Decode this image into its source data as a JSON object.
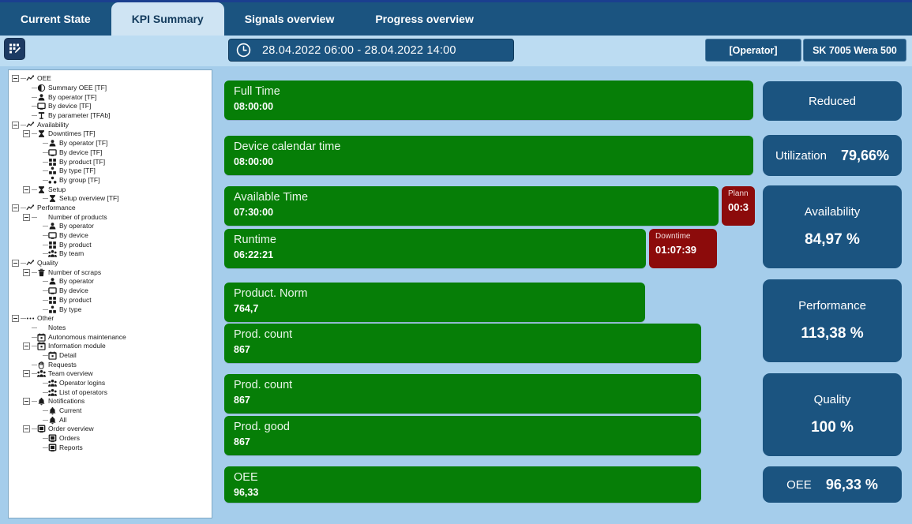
{
  "theme": {
    "background": "#a5cdeb",
    "header_blue": "#1b5480",
    "active_tab_bg": "#cfe4f3",
    "bar_green": "#067e07",
    "bar_red": "#8c0b0b",
    "panel_white": "#ffffff"
  },
  "tabs": [
    {
      "label": "Current State",
      "active": false
    },
    {
      "label": "KPI Summary",
      "active": true
    },
    {
      "label": "Signals overview",
      "active": false
    },
    {
      "label": "Progress overview",
      "active": false
    }
  ],
  "toolbar": {
    "form_icon": "form-edit-icon",
    "clock_icon": "clock-icon",
    "date_range": "28.04.2022 06:00 - 28.04.2022 14:00",
    "operator_button": "[Operator]",
    "device_button": "SK 7005 Wera 500"
  },
  "tree": [
    {
      "label": "OEE",
      "depth": 0,
      "toggle": true,
      "icon": "trend-icon"
    },
    {
      "label": "Summary OEE [TF]",
      "depth": 1,
      "toggle": false,
      "icon": "pie-icon"
    },
    {
      "label": "By operator [TF]",
      "depth": 1,
      "toggle": false,
      "icon": "operator-icon"
    },
    {
      "label": "By device [TF]",
      "depth": 1,
      "toggle": false,
      "icon": "device-icon"
    },
    {
      "label": "By parameter [TFAb]",
      "depth": 1,
      "toggle": false,
      "icon": "parameter-icon"
    },
    {
      "label": "Availability",
      "depth": 0,
      "toggle": true,
      "icon": "trend-icon"
    },
    {
      "label": "Downtimes [TF]",
      "depth": 1,
      "toggle": true,
      "icon": "hourglass-icon"
    },
    {
      "label": "By operator [TF]",
      "depth": 2,
      "toggle": false,
      "icon": "operator-icon"
    },
    {
      "label": "By device [TF]",
      "depth": 2,
      "toggle": false,
      "icon": "device-icon"
    },
    {
      "label": "By product [TF]",
      "depth": 2,
      "toggle": false,
      "icon": "product-icon"
    },
    {
      "label": "By type [TF]",
      "depth": 2,
      "toggle": false,
      "icon": "type-icon"
    },
    {
      "label": "By group [TF]",
      "depth": 2,
      "toggle": false,
      "icon": "group-icon"
    },
    {
      "label": "Setup",
      "depth": 1,
      "toggle": true,
      "icon": "hourglass-icon"
    },
    {
      "label": "Setup overview [TF]",
      "depth": 2,
      "toggle": false,
      "icon": "hourglass-icon"
    },
    {
      "label": "Performance",
      "depth": 0,
      "toggle": true,
      "icon": "trend-icon"
    },
    {
      "label": "Number of products",
      "depth": 1,
      "toggle": true,
      "icon": "none"
    },
    {
      "label": "By operator",
      "depth": 2,
      "toggle": false,
      "icon": "operator-icon"
    },
    {
      "label": "By device",
      "depth": 2,
      "toggle": false,
      "icon": "device-icon"
    },
    {
      "label": "By product",
      "depth": 2,
      "toggle": false,
      "icon": "product-icon"
    },
    {
      "label": "By team",
      "depth": 2,
      "toggle": false,
      "icon": "team-icon"
    },
    {
      "label": "Quality",
      "depth": 0,
      "toggle": true,
      "icon": "trend-icon"
    },
    {
      "label": "Number of scraps",
      "depth": 1,
      "toggle": true,
      "icon": "trash-icon"
    },
    {
      "label": "By operator",
      "depth": 2,
      "toggle": false,
      "icon": "operator-icon"
    },
    {
      "label": "By device",
      "depth": 2,
      "toggle": false,
      "icon": "device-icon"
    },
    {
      "label": "By product",
      "depth": 2,
      "toggle": false,
      "icon": "product-icon"
    },
    {
      "label": "By type",
      "depth": 2,
      "toggle": false,
      "icon": "type-icon"
    },
    {
      "label": "Other",
      "depth": 0,
      "toggle": true,
      "icon": "dots-icon"
    },
    {
      "label": "Notes",
      "depth": 1,
      "toggle": false,
      "icon": "none"
    },
    {
      "label": "Autonomous maintenance",
      "depth": 1,
      "toggle": false,
      "icon": "calendar-icon"
    },
    {
      "label": "Information module",
      "depth": 1,
      "toggle": true,
      "icon": "calendar-icon"
    },
    {
      "label": "Detail",
      "depth": 2,
      "toggle": false,
      "icon": "calendar-icon"
    },
    {
      "label": "Requests",
      "depth": 1,
      "toggle": false,
      "icon": "hand-icon"
    },
    {
      "label": "Team overview",
      "depth": 1,
      "toggle": true,
      "icon": "team-icon"
    },
    {
      "label": "Operator logins",
      "depth": 2,
      "toggle": false,
      "icon": "team-icon"
    },
    {
      "label": "List of operators",
      "depth": 2,
      "toggle": false,
      "icon": "team-icon"
    },
    {
      "label": "Notifications",
      "depth": 1,
      "toggle": true,
      "icon": "bell-icon"
    },
    {
      "label": "Current",
      "depth": 2,
      "toggle": false,
      "icon": "bell-icon"
    },
    {
      "label": "All",
      "depth": 2,
      "toggle": false,
      "icon": "bell-icon"
    },
    {
      "label": "Order overview",
      "depth": 1,
      "toggle": true,
      "icon": "order-icon"
    },
    {
      "label": "Orders",
      "depth": 2,
      "toggle": false,
      "icon": "order-icon"
    },
    {
      "label": "Reports",
      "depth": 2,
      "toggle": false,
      "icon": "order-icon"
    }
  ],
  "bars": [
    {
      "title": "Full Time",
      "value": "08:00:00"
    },
    {
      "title": "Device calendar time",
      "value": "08:00:00"
    },
    {
      "title": "Available Time",
      "value": "07:30:00"
    },
    {
      "title": "Runtime",
      "value": "06:22:21"
    },
    {
      "title": "Product. Norm",
      "value": "764,7"
    },
    {
      "title": "Prod. count",
      "value": "867"
    },
    {
      "title": "Prod. count",
      "value": "867"
    },
    {
      "title": "Prod. good",
      "value": "867"
    },
    {
      "title": "OEE",
      "value": "96,33"
    }
  ],
  "red_boxes": [
    {
      "title": "Plann",
      "value": "00:3"
    },
    {
      "title": "Downtime",
      "value": "01:07:39"
    }
  ],
  "kpis": [
    {
      "name": "Reduced",
      "value": ""
    },
    {
      "name": "Utilization",
      "value": "79,66%"
    },
    {
      "name": "Availability",
      "value": "84,97 %"
    },
    {
      "name": "Performance",
      "value": "113,38 %"
    },
    {
      "name": "Quality",
      "value": "100 %"
    },
    {
      "name": "OEE",
      "value": "96,33 %"
    }
  ]
}
